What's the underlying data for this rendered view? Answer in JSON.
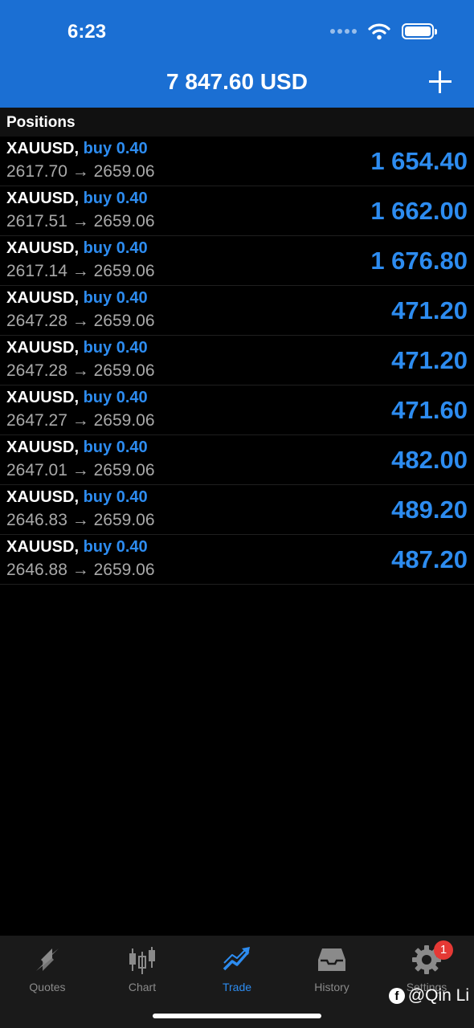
{
  "status": {
    "time": "6:23"
  },
  "header": {
    "balance": "7 847.60 USD"
  },
  "section": {
    "title": "Positions"
  },
  "positions": [
    {
      "symbol": "XAUUSD,",
      "side": "buy 0.40",
      "open_price": "2617.70",
      "arrow": "→",
      "current_price": "2659.06",
      "profit": "1 654.40"
    },
    {
      "symbol": "XAUUSD,",
      "side": "buy 0.40",
      "open_price": "2617.51",
      "arrow": "→",
      "current_price": "2659.06",
      "profit": "1 662.00"
    },
    {
      "symbol": "XAUUSD,",
      "side": "buy 0.40",
      "open_price": "2617.14",
      "arrow": "→",
      "current_price": "2659.06",
      "profit": "1 676.80"
    },
    {
      "symbol": "XAUUSD,",
      "side": "buy 0.40",
      "open_price": "2647.28",
      "arrow": "→",
      "current_price": "2659.06",
      "profit": "471.20"
    },
    {
      "symbol": "XAUUSD,",
      "side": "buy 0.40",
      "open_price": "2647.28",
      "arrow": "→",
      "current_price": "2659.06",
      "profit": "471.20"
    },
    {
      "symbol": "XAUUSD,",
      "side": "buy 0.40",
      "open_price": "2647.27",
      "arrow": "→",
      "current_price": "2659.06",
      "profit": "471.60"
    },
    {
      "symbol": "XAUUSD,",
      "side": "buy 0.40",
      "open_price": "2647.01",
      "arrow": "→",
      "current_price": "2659.06",
      "profit": "482.00"
    },
    {
      "symbol": "XAUUSD,",
      "side": "buy 0.40",
      "open_price": "2646.83",
      "arrow": "→",
      "current_price": "2659.06",
      "profit": "489.20"
    },
    {
      "symbol": "XAUUSD,",
      "side": "buy 0.40",
      "open_price": "2646.88",
      "arrow": "→",
      "current_price": "2659.06",
      "profit": "487.20"
    }
  ],
  "tabs": [
    {
      "label": "Quotes",
      "icon": "quotes-icon",
      "active": false
    },
    {
      "label": "Chart",
      "icon": "chart-icon",
      "active": false
    },
    {
      "label": "Trade",
      "icon": "trade-icon",
      "active": true
    },
    {
      "label": "History",
      "icon": "history-icon",
      "active": false
    },
    {
      "label": "Settings",
      "icon": "settings-icon",
      "active": false,
      "badge": "1"
    }
  ],
  "watermark": {
    "text": "@Qin Li"
  },
  "colors": {
    "header_bg": "#1b6fd3",
    "accent": "#2d8cf0",
    "badge": "#e53935"
  }
}
